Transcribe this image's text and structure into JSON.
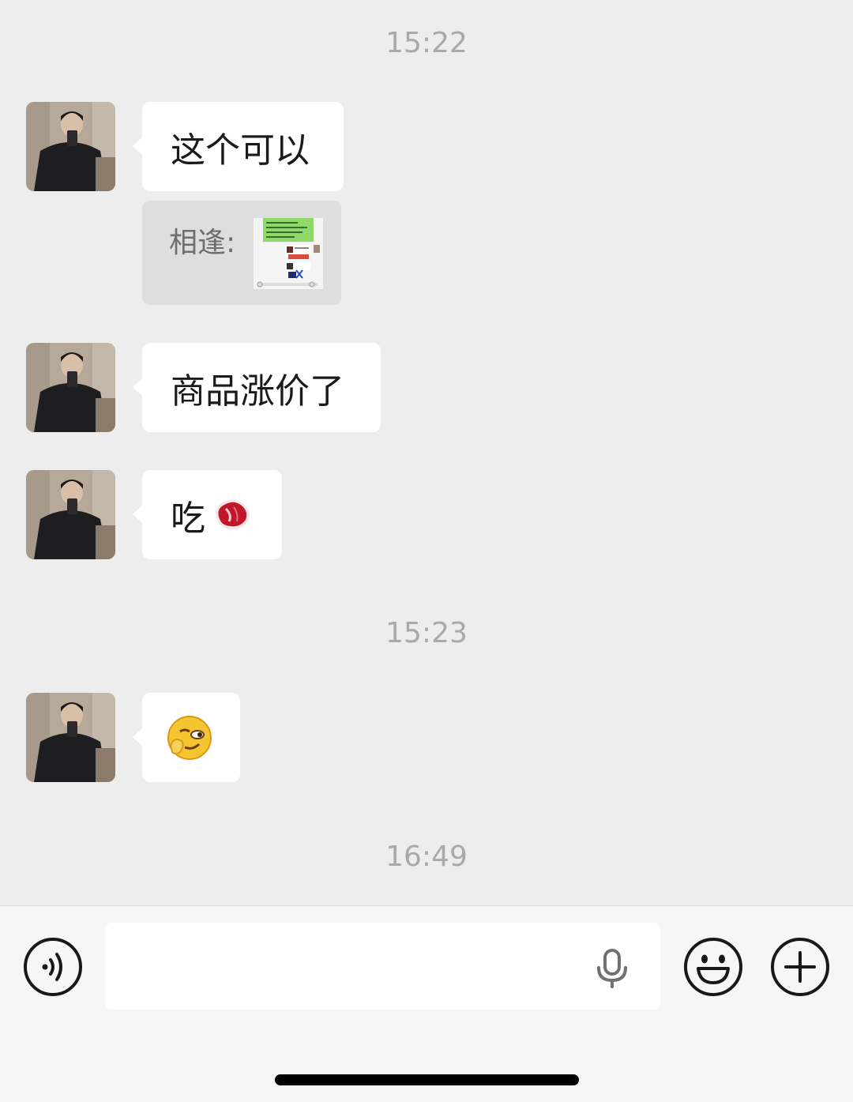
{
  "timestamps": [
    "15:22",
    "15:23",
    "16:49"
  ],
  "messages": [
    {
      "text": "这个可以"
    },
    {
      "quote_label": "相逢:"
    },
    {
      "text": "商品涨价了"
    },
    {
      "text": "吃"
    },
    {
      "emoji": "smirk"
    }
  ],
  "input": {
    "value": "",
    "placeholder": ""
  },
  "icons": {
    "voice": "voice-mode-icon",
    "mic": "microphone-icon",
    "emoji": "emoji-icon",
    "plus": "plus-icon"
  }
}
